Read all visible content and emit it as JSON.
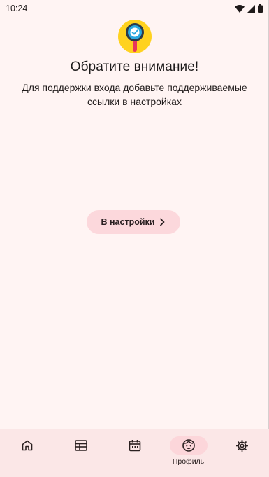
{
  "status_bar": {
    "time": "10:24",
    "icons": [
      "wifi-icon",
      "signal-icon",
      "battery-icon"
    ]
  },
  "hero": {
    "icon": "magnifier-check-icon",
    "title": "Обратите внимание!",
    "description": "Для поддержки входа добавьте поддерживаемые ссылки в настройках"
  },
  "settings_button": {
    "label": "В настройки",
    "icon": "chevron-right-icon"
  },
  "bottom_nav": {
    "items": [
      {
        "icon": "home-icon",
        "label": "",
        "active": false
      },
      {
        "icon": "schedule-icon",
        "label": "",
        "active": false
      },
      {
        "icon": "calendar-icon",
        "label": "",
        "active": false
      },
      {
        "icon": "profile-face-icon",
        "label": "Профиль",
        "active": true
      },
      {
        "icon": "gear-icon",
        "label": "",
        "active": false
      }
    ]
  },
  "colors": {
    "background": "#fff4f3",
    "button_bg": "#fcd8dc",
    "nav_bg": "#fbe7e7",
    "nav_active_pill": "#fcd6da",
    "icon_yellow": "#ffd21f",
    "icon_blue": "#29a8e0",
    "icon_red": "#e8375b"
  }
}
